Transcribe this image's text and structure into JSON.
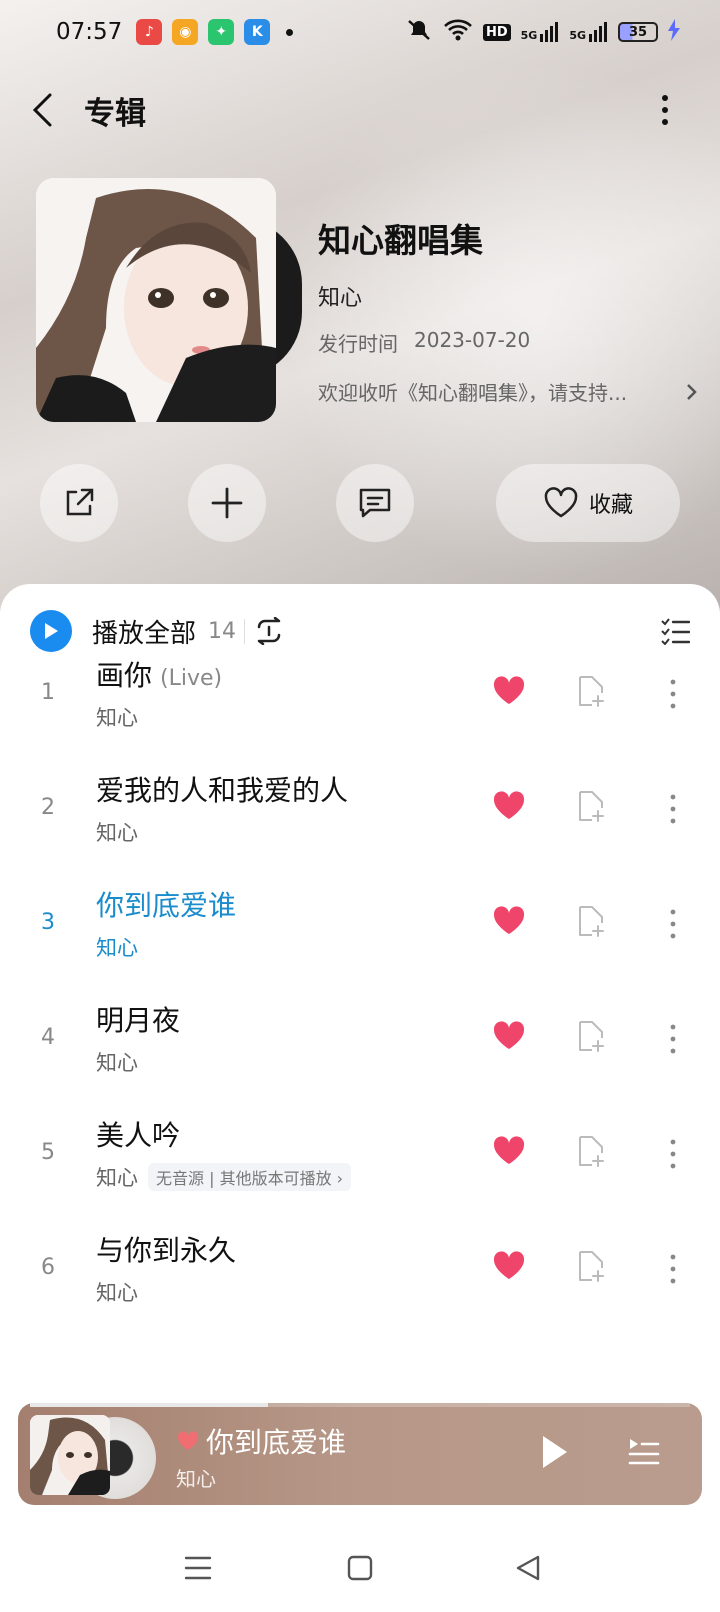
{
  "status": {
    "time": "07:57",
    "network_label": "HD",
    "signal1_label": "5G",
    "signal2_label": "5G",
    "battery": "35"
  },
  "header": {
    "title": "专辑"
  },
  "album": {
    "name": "知心翻唱集",
    "artist": "知心",
    "date_label": "发行时间",
    "date": "2023-07-20",
    "description": "欢迎收听《知心翻唱集》，请支持..."
  },
  "actions": {
    "favorite_label": "收藏"
  },
  "playlist": {
    "play_all_label": "播放全部",
    "count": "14"
  },
  "songs": [
    {
      "num": "1",
      "title": "画你",
      "tag": "(Live)",
      "artist": "知心",
      "note": ""
    },
    {
      "num": "2",
      "title": "爱我的人和我爱的人",
      "tag": "",
      "artist": "知心",
      "note": ""
    },
    {
      "num": "3",
      "title": "你到底爱谁",
      "tag": "",
      "artist": "知心",
      "note": ""
    },
    {
      "num": "4",
      "title": "明月夜",
      "tag": "",
      "artist": "知心",
      "note": ""
    },
    {
      "num": "5",
      "title": "美人吟",
      "tag": "",
      "artist": "知心",
      "note": "无音源 | 其他版本可播放 ›"
    },
    {
      "num": "6",
      "title": "与你到永久",
      "tag": "",
      "artist": "知心",
      "note": ""
    }
  ],
  "mini_player": {
    "title": "你到底爱谁",
    "artist": "知心",
    "progress": 0.36
  },
  "colors": {
    "accent": "#1a8cf0",
    "heart": "#f0456a",
    "active_text": "#1a8ccc"
  }
}
